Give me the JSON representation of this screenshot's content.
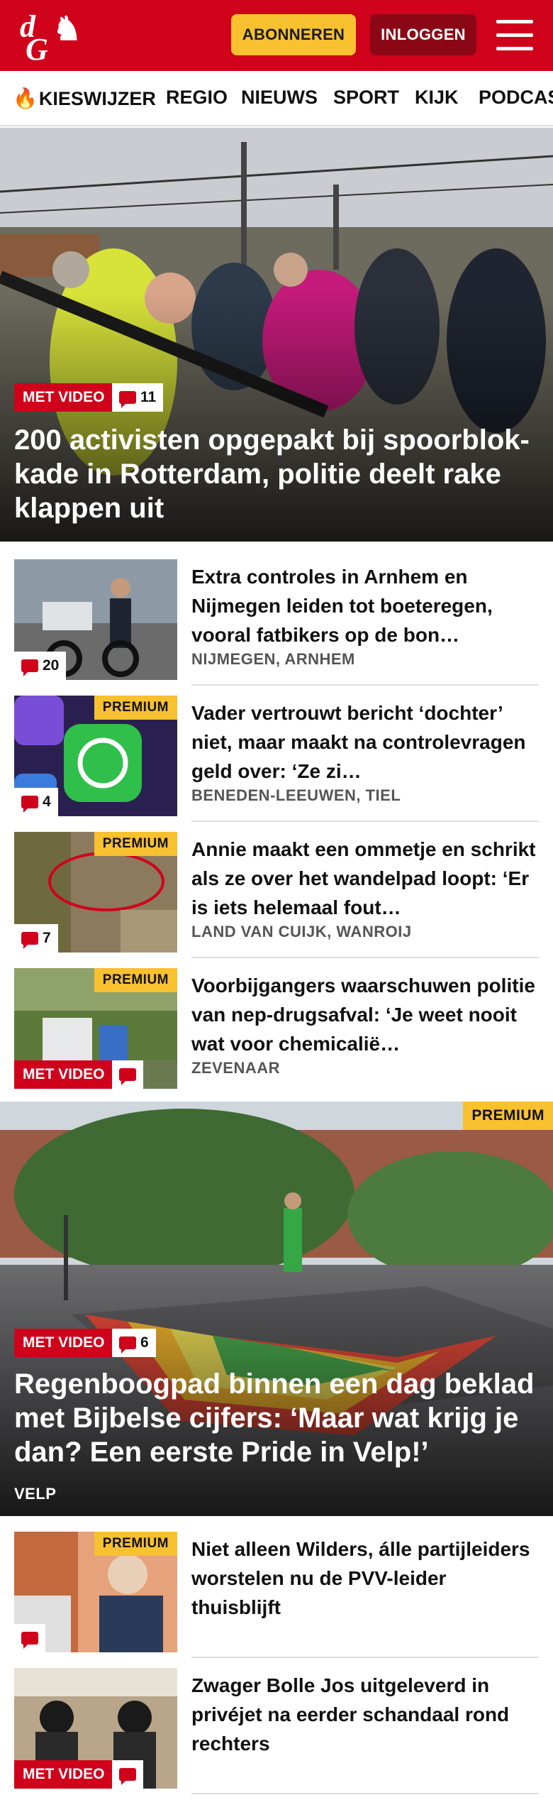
{
  "header": {
    "subscribe_label": "ABONNEREN",
    "login_label": "INLOGGEN",
    "brand_color": "#d0021b"
  },
  "nav": {
    "items": [
      "KIESWIJZER",
      "REGIO",
      "NIEUWS",
      "SPORT",
      "KIJK",
      "PODCAS"
    ]
  },
  "hero1": {
    "video_label": "MET VIDEO",
    "comments": "11",
    "title": "200 activisten opgepakt bij spoorblok­kade in Rotterdam, politie deelt rake klappen uit"
  },
  "articles": [
    {
      "title": "Extra controles in Arnhem en Nijmegen leiden tot boeteregen, vooral fatbikers op de bon…",
      "location": "NIJMEGEN, ARNHEM",
      "comments": "20",
      "premium": ""
    },
    {
      "title": "Vader vertrouwt bericht ‘dochter’ niet, maar maakt na controlevragen geld over: ‘Ze zi…",
      "location": "BENEDEN-LEEUWEN, TIEL",
      "comments": "4",
      "premium": "PREMIUM"
    },
    {
      "title": "Annie maakt een ommetje en schrikt als ze over het wandelpad loopt: ‘Er is iets helemaal fout…",
      "location": "LAND VAN CUIJK, WANROIJ",
      "comments": "7",
      "premium": "PREMIUM"
    },
    {
      "title": "Voorbijgangers waarschuwen politie van nep-drugsafval: ‘Je weet nooit wat voor chemicalië…",
      "location": "ZEVENAAR",
      "video_label": "MET VIDEO",
      "premium": "PREMIUM"
    }
  ],
  "hero2": {
    "premium": "PREMIUM",
    "video_label": "MET VIDEO",
    "comments": "6",
    "title": "Regenboogpad binnen een dag beklad met Bijbelse cijfers: ‘Maar wat krijg je dan? Een eerste Pride in Velp!’",
    "location": "VELP"
  },
  "articles2": [
    {
      "title": "Niet alleen Wilders, álle partijlei­ders worstelen nu de PVV-leider thuisblijft",
      "premium": "PREMIUM"
    },
    {
      "title": "Zwager Bolle Jos uitgeleverd in privéjet na eerder schandaal rond rechters",
      "video_label": "MET VIDEO"
    }
  ]
}
